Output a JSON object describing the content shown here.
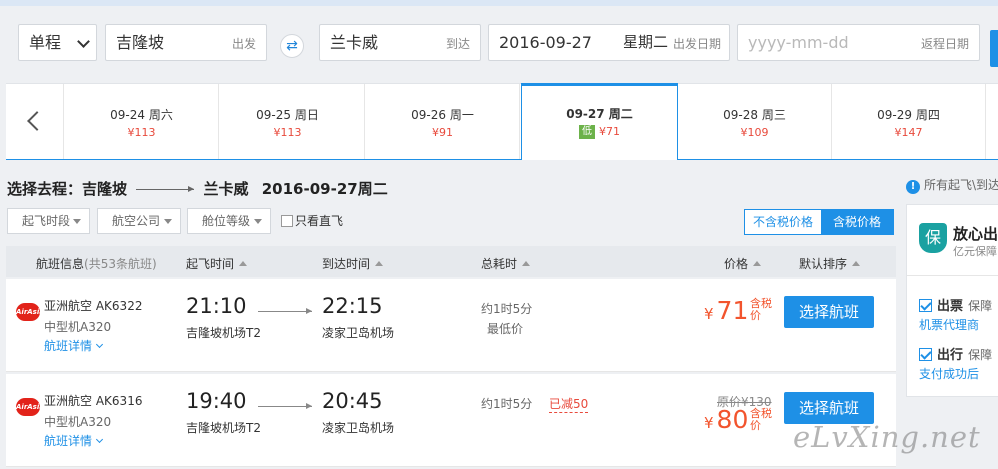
{
  "search": {
    "trip_type": "单程",
    "from_city": "吉隆坡",
    "from_hint": "出发",
    "to_city": "兰卡威",
    "to_hint": "到达",
    "dep_date": "2016-09-27",
    "dep_week": "星期二",
    "dep_hint": "出发日期",
    "ret_placeholder": "yyyy-mm-dd",
    "ret_hint": "返程日期"
  },
  "dates": [
    {
      "label": "09-24 周六",
      "price": "¥113"
    },
    {
      "label": "09-25 周日",
      "price": "¥113"
    },
    {
      "label": "09-26 周一",
      "price": "¥91"
    },
    {
      "label": "09-27 周二",
      "price": "¥71",
      "badge": "低"
    },
    {
      "label": "09-28 周三",
      "price": "¥109"
    },
    {
      "label": "09-29 周四",
      "price": "¥147"
    }
  ],
  "route": {
    "prefix": "选择去程：",
    "from": "吉隆坡",
    "to": "兰卡威",
    "date": "2016-09-27周二"
  },
  "filters": {
    "time": "起飞时段",
    "airline": "航空公司",
    "cabin": "舱位等级",
    "direct": "只看直飞",
    "excl_tax": "不含税价格",
    "incl_tax": "含税价格"
  },
  "table_header": {
    "flight_info": "航班信息",
    "flight_count": "(共53条航班)",
    "dep_time": "起飞时间",
    "arr_time": "到达时间",
    "duration": "总耗时",
    "price": "价格",
    "sort": "默认排序"
  },
  "flights": [
    {
      "logo": "AirAsia",
      "airline": "亚洲航空",
      "code": "AK6322",
      "plane": "中型机A320",
      "details": "航班详情",
      "dep_time": "21:10",
      "dep_airport": "吉隆坡机场T2",
      "arr_time": "22:15",
      "arr_airport": "凌家卫岛机场",
      "duration": "约1时5分",
      "tag": "最低价",
      "yen": "¥",
      "price": "71",
      "tax_note": "含税价",
      "button": "选择航班"
    },
    {
      "logo": "AirAsia",
      "airline": "亚洲航空",
      "code": "AK6316",
      "plane": "中型机A320",
      "details": "航班详情",
      "dep_time": "19:40",
      "dep_airport": "吉隆坡机场T2",
      "arr_time": "20:45",
      "arr_airport": "凌家卫岛机场",
      "duration": "约1时5分",
      "reduced": "已减50",
      "original_price": "原价¥130",
      "yen": "¥",
      "price": "80",
      "tax_note": "含税价",
      "button": "选择航班"
    }
  ],
  "sidebar": {
    "notice": "所有起飞\\到达",
    "shield": "保",
    "title": "放心出",
    "subtitle": "亿元保障",
    "item1_label": "出票",
    "item1_desc": "保障",
    "item1_link": "机票代理商",
    "item2_label": "出行",
    "item2_desc": "保障",
    "item2_link": "支付成功后"
  },
  "watermark": "eLvXing.net",
  "colors": {
    "accent": "#1e90e6",
    "price": "#f2542d",
    "low_badge": "#6cb24a"
  }
}
